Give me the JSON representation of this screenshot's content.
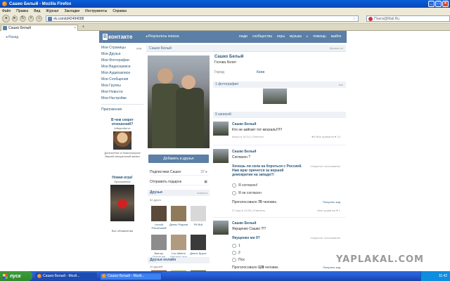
{
  "window": {
    "title": "Сашко Белый - Mozilla Firefox",
    "controls": [
      "_",
      "□",
      "×"
    ]
  },
  "menu": [
    "Файл",
    "Правка",
    "Вид",
    "Журнал",
    "Закладки",
    "Инструменты",
    "Справка"
  ],
  "nav": {
    "url": "vk.com/id42494088",
    "search_placeholder": "Поиск@Mail.Ru"
  },
  "tabs": [
    {
      "label": "Сашко Белый"
    }
  ],
  "page": {
    "back_link": "◂  Назад",
    "vk": {
      "logo_b": "В",
      "logo_text": "контакте",
      "search_results": "◂ Результаты поиска",
      "nav": [
        "люди",
        "сообщества",
        "игры",
        "музыка",
        "помощь",
        "выйти"
      ]
    },
    "left_menu": [
      {
        "label": "Мои Страницы",
        "sub": "ред."
      },
      {
        "label": "Мои Друзья",
        "sub": ""
      },
      {
        "label": "Мои Фотографии",
        "sub": ""
      },
      {
        "label": "Мои Видеозаписи",
        "sub": ""
      },
      {
        "label": "Мои Аудиозаписи",
        "sub": ""
      },
      {
        "label": "Мои Сообщения",
        "sub": ""
      },
      {
        "label": "Мои Группы",
        "sub": ""
      },
      {
        "label": "Мои Новости",
        "sub": ""
      },
      {
        "label": "Мои Настройки",
        "sub": ""
      }
    ],
    "applications": "Приложения",
    "ads": [
      {
        "title": "В чем секрет отношений?",
        "domain": "lofleprofist.ru",
        "desc": "Долголетие и благополучие Вашей сексуальной жизни"
      },
      {
        "title": "Новая игра!",
        "domain": "Приложение"
      }
    ],
    "all_ads": "Все объявления",
    "profile": {
      "header_name": "Сашко Белый",
      "edit": "Кривые из",
      "name": "Сашко Белый",
      "status": "Голова болит",
      "city_label": "Город:",
      "city": "Киев",
      "add_friend": "Добавить в друзья",
      "subscribers": "Подписчики Сашко",
      "subscribers_count": "37 ▸",
      "send_gift": "Отправить подарок",
      "gift_icon": "gift-icon",
      "friends_header": "Друзья",
      "friends_news": "новости",
      "friends_count": "62 друга",
      "friends": [
        {
          "name": "Leonid Polozhodoff",
          "color": "#5a4a3a"
        },
        {
          "name": "Денис Роднов",
          "color": "#8f7a5a"
        },
        {
          "name": "Pit Bull",
          "color": "#d8d8d8"
        },
        {
          "name": "Виктор Поповцев",
          "color": "#8c8c8c"
        },
        {
          "name": "Lux Alberto Servant Lapa",
          "color": "#b09a80"
        },
        {
          "name": "Денис Брусе",
          "color": "#3a3a3a"
        }
      ],
      "online_header": "Друзья онлайн",
      "online_count": "10 друзей",
      "online_friends": [
        {
          "color": "#6a3a2a"
        },
        {
          "color": "#9ab070"
        },
        {
          "color": "#4a5a3a"
        }
      ],
      "photos_header": "1 фотография",
      "photos_all": "все",
      "wall_header": "9 записей",
      "posts": [
        {
          "author": "Сашко Белый",
          "text": "Кто не зайгает тот москаль!!!!!!",
          "meta": "вчера в 16:14  |  Ответить",
          "right": "♥6  Мне нравится ♥ 10"
        },
        {
          "author": "Сашко Белый",
          "text": "Согласен ?",
          "poll_title": "Хочешь ли сила на бороться с Россией. Нам враг прячется за вершей демократии на западе!!!",
          "poll_type": "Открытое голосование",
          "options": [
            "Я согласен!",
            "Я не согласен"
          ],
          "voted_prefix": "Проголосовало ",
          "voted_num": "70",
          "voted_suffix": " человек.",
          "get_code": "Получить код",
          "meta": "27 мар в 11:55  |  Ответить",
          "right": "Мне нравится ♥ 1"
        },
        {
          "author": "Сашко Белый",
          "text": "Якущенко Сашко ?!?",
          "poll_title": "Якущенко ми 9?",
          "poll_type": "Открытое голосование",
          "options": [
            "1",
            "2",
            "Пох"
          ],
          "voted_prefix": "Проголосовало ",
          "voted_num": "128",
          "voted_suffix": " человек.",
          "get_code": "Получить код"
        }
      ]
    },
    "watermark": "YAPLAKAL.COM"
  },
  "taskbar": {
    "start": "пуск",
    "items": [
      {
        "label": "Сашко Белый - Mozil..."
      },
      {
        "label": "Сашко Белый - Mozil..."
      }
    ],
    "clock": "11:42"
  }
}
